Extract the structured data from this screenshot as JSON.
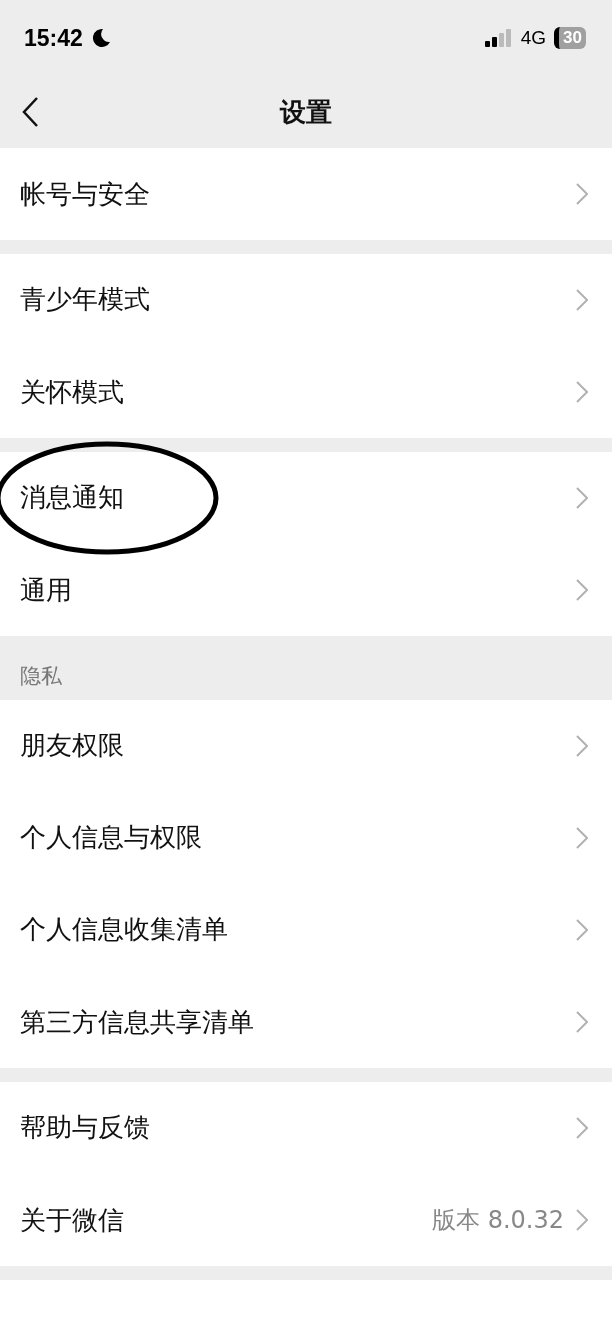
{
  "status_bar": {
    "time": "15:42",
    "network": "4G",
    "battery": "30"
  },
  "nav": {
    "title": "设置"
  },
  "groups": [
    {
      "items": [
        {
          "label": "帐号与安全",
          "circled": false
        }
      ]
    },
    {
      "items": [
        {
          "label": "青少年模式",
          "circled": false
        },
        {
          "label": "关怀模式",
          "circled": false
        }
      ]
    },
    {
      "items": [
        {
          "label": "消息通知",
          "circled": true
        },
        {
          "label": "通用",
          "circled": false
        }
      ]
    },
    {
      "header": "隐私",
      "items": [
        {
          "label": "朋友权限",
          "circled": false
        },
        {
          "label": "个人信息与权限",
          "circled": false
        },
        {
          "label": "个人信息收集清单",
          "circled": false
        },
        {
          "label": "第三方信息共享清单",
          "circled": false
        }
      ]
    },
    {
      "items": [
        {
          "label": "帮助与反馈",
          "circled": false
        },
        {
          "label": "关于微信",
          "value": "版本 8.0.32",
          "circled": false
        }
      ]
    }
  ]
}
